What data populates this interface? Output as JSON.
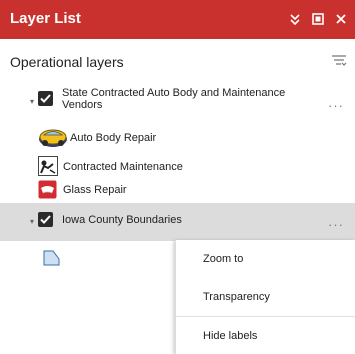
{
  "window": {
    "title": "Layer List",
    "controls": [
      "collapse-icon",
      "maximize-icon",
      "close-icon"
    ],
    "accent_color": "#c8312e"
  },
  "panel": {
    "header_label": "Operational layers",
    "filter_icon": "filter-icon"
  },
  "layers": [
    {
      "name": "State Contracted Auto Body and Maintenance Vendors",
      "expanded": true,
      "checked": true,
      "legend": [
        {
          "label": "Auto Body Repair",
          "icon": "car-icon"
        },
        {
          "label": "Contracted Maintenance",
          "icon": "mechanic-icon"
        },
        {
          "label": "Glass Repair",
          "icon": "windshield-icon"
        }
      ]
    },
    {
      "name": "Iowa County Boundaries",
      "expanded": true,
      "checked": true,
      "selected": true,
      "legend": [
        {
          "label": "",
          "icon": "polygon-icon"
        }
      ]
    }
  ],
  "context_menu": {
    "items": [
      {
        "label": "Zoom to"
      },
      {
        "label": "Transparency"
      },
      {
        "label": "Hide labels"
      }
    ]
  }
}
